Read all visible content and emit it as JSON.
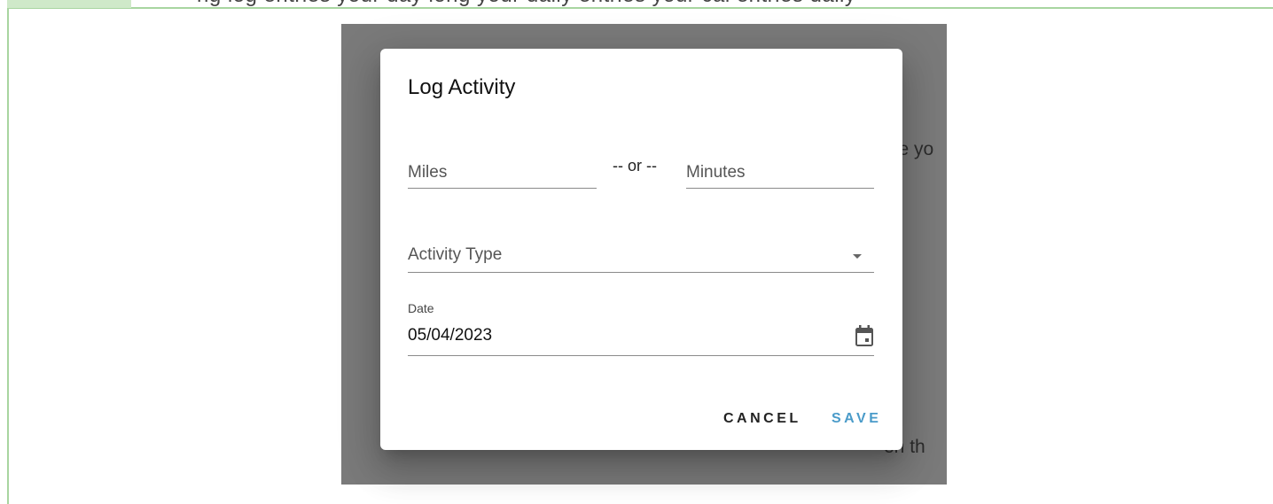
{
  "background": {
    "top_text": "ng log entries your day long your daily entries your cal entries daily",
    "text_1": "ce yo",
    "text_2": "en th"
  },
  "dialog": {
    "title": "Log Activity",
    "miles_placeholder": "Miles",
    "or_separator": "-- or --",
    "minutes_placeholder": "Minutes",
    "activity_type_placeholder": "Activity Type",
    "date_label": "Date",
    "date_value": "05/04/2023",
    "cancel_label": "CANCEL",
    "save_label": "SAVE"
  },
  "colors": {
    "accent": "#4a9bc9",
    "frame_border": "#a8d5a0",
    "overlay": "#7a7a7a"
  },
  "icons": {
    "dropdown": "chevron-down-icon",
    "calendar": "calendar-icon"
  }
}
